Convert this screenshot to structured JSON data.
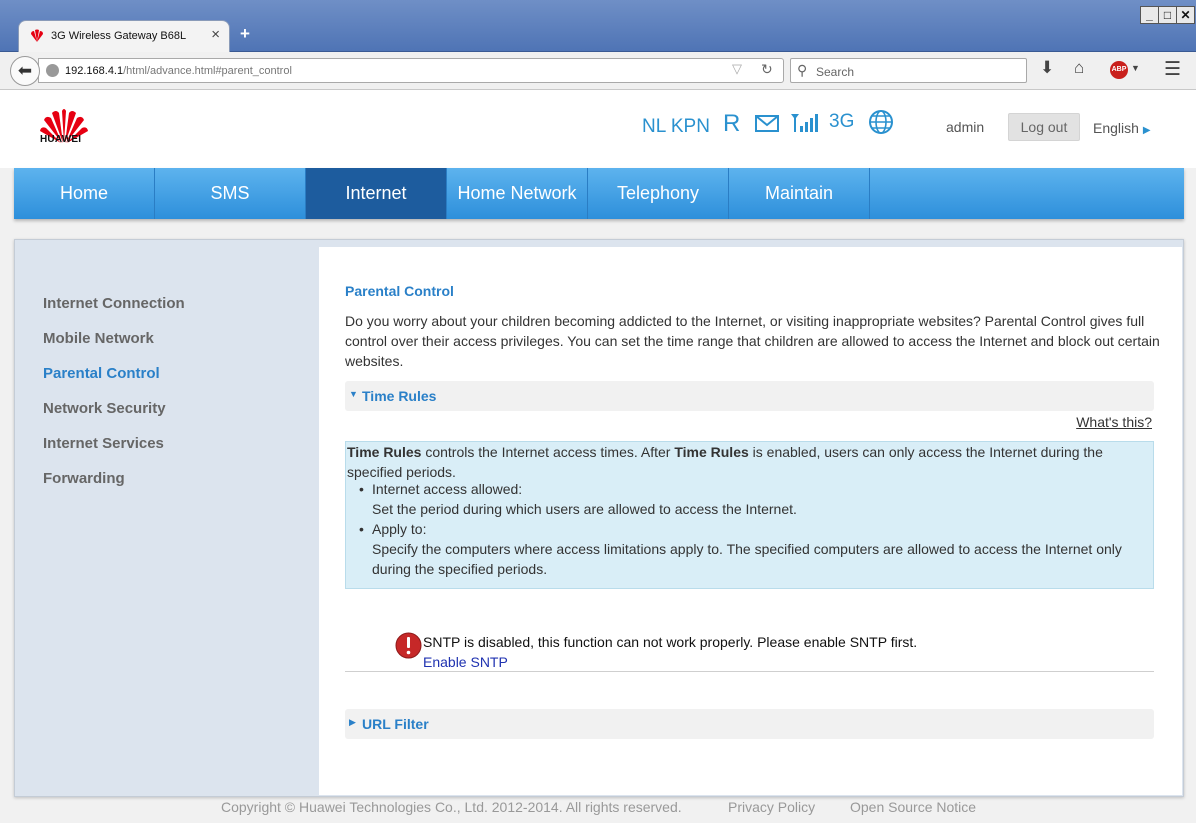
{
  "browser": {
    "tab_title": "3G Wireless Gateway B68L",
    "tab_close": "×",
    "new_tab": "+",
    "url_host": "192.168.4.1",
    "url_path": "/html/advance.html#parent_control",
    "search_placeholder": "Search",
    "window_min": "_",
    "window_max": "□",
    "window_close": "✕",
    "abp": "ABP",
    "icons": [
      "back-arrow-icon",
      "globe-icon",
      "reload-icon",
      "search-icon",
      "download-icon",
      "home-icon",
      "adblock-icon",
      "menu-icon"
    ]
  },
  "header": {
    "operator": "NL KPN",
    "roaming": "R",
    "network_type": "3G",
    "user": "admin",
    "logout": "Log out",
    "language": "English"
  },
  "logo": {
    "text": "HUAWEI",
    "color": "#e60012"
  },
  "nav": {
    "items": [
      "Home",
      "SMS",
      "Internet",
      "Home Network",
      "Telephony",
      "Maintain"
    ],
    "active": "Internet"
  },
  "sidebar": {
    "items": [
      "Internet Connection",
      "Mobile Network",
      "Parental Control",
      "Network Security",
      "Internet Services",
      "Forwarding"
    ],
    "active": "Parental Control"
  },
  "content": {
    "title": "Parental Control",
    "intro": "Do you worry about your children becoming addicted to the Internet, or visiting inappropriate websites? Parental Control gives full control over their access privileges. You can set the time range that children are allowed to access the Internet and block out certain websites.",
    "time_rules_label": "Time Rules",
    "whats_this": "What's this?",
    "help": {
      "lead_bold": "Time Rules",
      "lead_1": " controls the Internet access times. After ",
      "lead_bold_2": "Time Rules",
      "lead_2": " is enabled, users can only access the Internet during the specified periods.",
      "item1_title": "Internet access allowed:",
      "item1_desc": "Set the period during which users are allowed to access the Internet.",
      "item2_title": "Apply to:",
      "item2_desc": "Specify the computers where access limitations apply to. The specified computers are allowed to access the Internet only during the specified periods."
    },
    "warning": "SNTP is disabled, this function can not work properly. Please enable SNTP first.",
    "enable_sntp": "Enable SNTP",
    "url_filter_label": "URL Filter"
  },
  "footer": {
    "copyright": "Copyright © Huawei Technologies Co., Ltd. 2012-2014. All rights reserved.",
    "privacy": "Privacy Policy",
    "open_source": "Open Source Notice"
  },
  "colors": {
    "accent": "#2a80c8",
    "nav": "#2d8fdb",
    "nav_active": "#1d5c9e",
    "warning": "#c62828"
  }
}
